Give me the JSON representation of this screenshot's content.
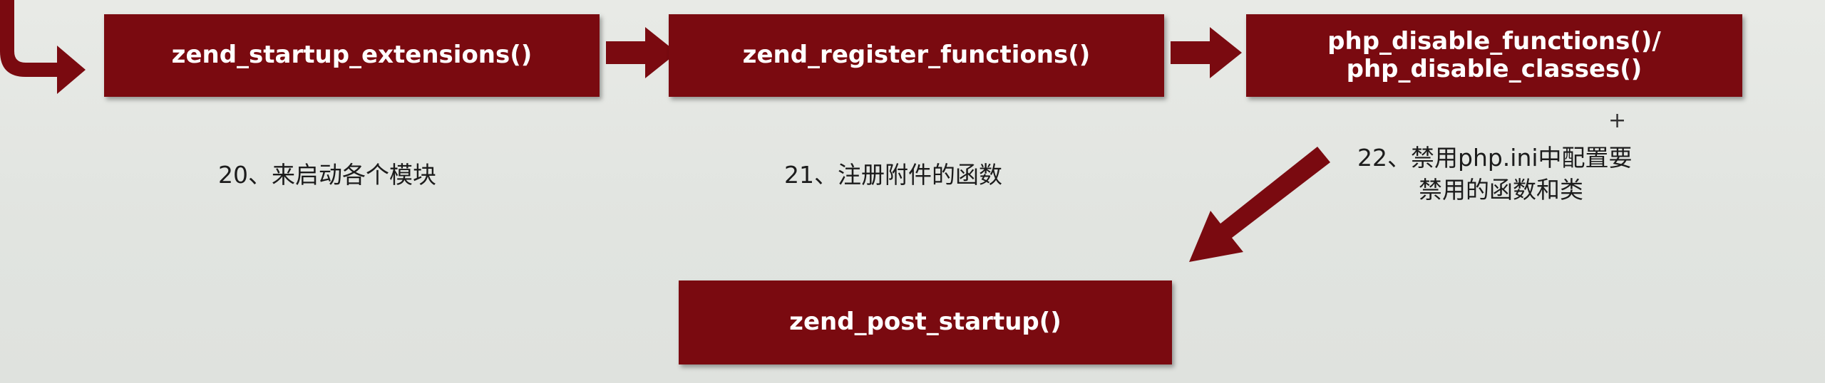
{
  "boxes": {
    "startup_extensions": "zend_startup_extensions()",
    "register_functions": "zend_register_functions()",
    "disable_line1": "php_disable_functions()/",
    "disable_line2": "php_disable_classes()",
    "post_startup": "zend_post_startup()"
  },
  "labels": {
    "step20": "20、来启动各个模块",
    "step21": "21、注册附件的函数",
    "step22_line1": "22、禁用php.ini中配置要",
    "step22_line2": "禁用的函数和类"
  },
  "plus_mark": "+",
  "colors": {
    "box_fill": "#7a0a10",
    "arrow_fill": "#7a0a10",
    "background": "#e3e6e2",
    "overlay_text": "#3ab0f0"
  }
}
